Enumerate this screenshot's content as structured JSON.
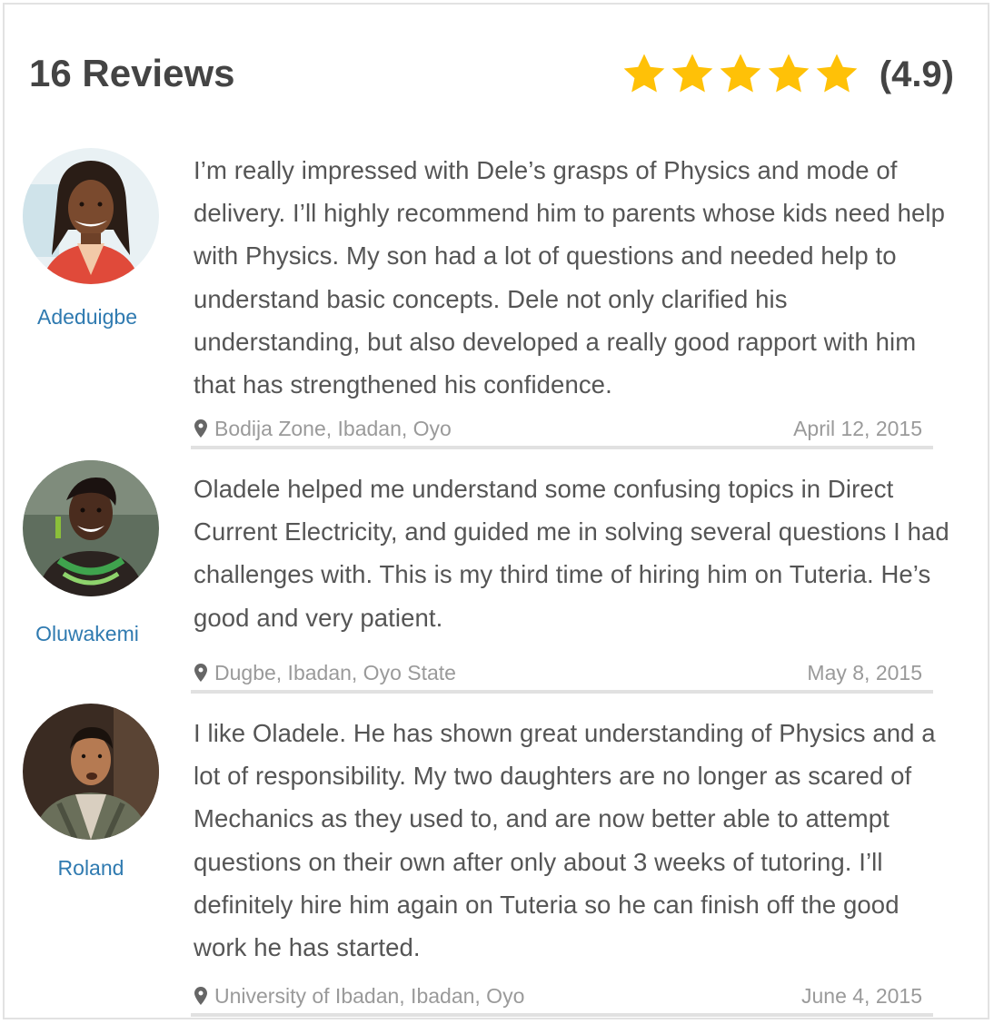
{
  "header": {
    "title": "16 Reviews",
    "rating_value": "(4.9)",
    "stars": 5,
    "star_color": "#FFC107"
  },
  "colors": {
    "name": "#2f7ab0",
    "text": "#555555",
    "meta": "#9a9a9a"
  },
  "reviews": [
    {
      "name": "Adeduigbe",
      "avatar_icon": "woman-with-locs-avatar",
      "text": "I’m really impressed with Dele’s grasps of Physics and mode of delivery. I’ll highly recommend him to parents whose kids need help with Physics. My son had a lot of questions and needed help to understand basic concepts. Dele not only clarified his understanding, but also developed a really good rapport with him that has strengthened his confidence.",
      "location": "Bodija Zone, Ibadan, Oyo",
      "date": "April 12, 2015"
    },
    {
      "name": "Oluwakemi",
      "avatar_icon": "smiling-woman-avatar",
      "text": "Oladele helped me understand some confusing topics in Direct Current Electricity, and guided me in solving several questions I had challenges with. This is my third time of hiring him on Tuteria. He’s good and very patient.",
      "location": "Dugbe, Ibadan, Oyo State",
      "date": "May 8, 2015"
    },
    {
      "name": "Roland",
      "avatar_icon": "man-in-cardigan-avatar",
      "text": "I like Oladele. He has shown great understanding of Physics and a lot of responsibility. My two daughters are no longer as scared of Mechanics as they used to, and are now better able to attempt questions on their own after only about 3 weeks of tutoring. I’ll definitely hire him again on Tuteria so he can finish off  the good work he has started.",
      "location": "University of Ibadan, Ibadan, Oyo",
      "date": "June 4, 2015"
    }
  ]
}
